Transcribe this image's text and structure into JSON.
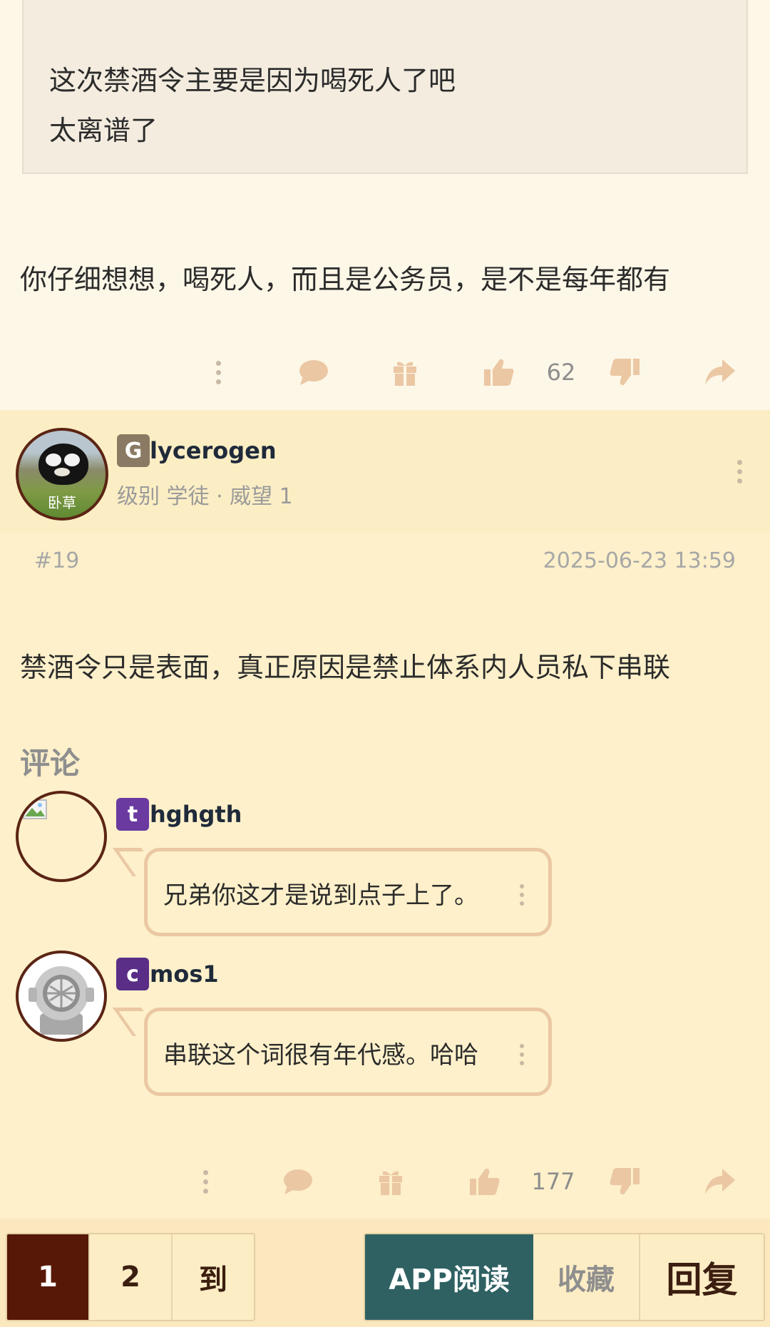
{
  "prev_post": {
    "quote_lines": [
      "这次禁酒令主要是因为喝死人了吧",
      "太离谱了"
    ],
    "text": "你仔细想想，喝死人，而且是公务员，是不是每年都有",
    "actions": {
      "like_count": "62"
    }
  },
  "reply": {
    "user": {
      "badge_letter": "G",
      "badge_color": "#8a7a63",
      "name": "lycerogen",
      "level": "级别 学徒 · 威望 1",
      "avatar_caption": "卧草"
    },
    "floor": "#19",
    "time": "2025-06-23 13:59",
    "text": "禁酒令只是表面，真正原因是禁止体系内人员私下串联",
    "comments_title": "评论",
    "comments": [
      {
        "badge_letter": "t",
        "badge_color": "#6a3aa0",
        "name": "hghgth",
        "text": "兄弟你这才是说到点子上了。"
      },
      {
        "badge_letter": "c",
        "badge_color": "#5a2e86",
        "name": "mos1",
        "text": "串联这个词很有年代感。哈哈"
      }
    ],
    "actions": {
      "like_count": "177"
    }
  },
  "bottom_nav": {
    "pages": [
      "1",
      "2",
      "到"
    ],
    "app_read": "APP阅读",
    "favorite": "收藏",
    "reply": "回复"
  },
  "colors": {
    "icon": "#ebc7a4",
    "accent_dark": "#571808",
    "app_button": "#2f6163"
  }
}
